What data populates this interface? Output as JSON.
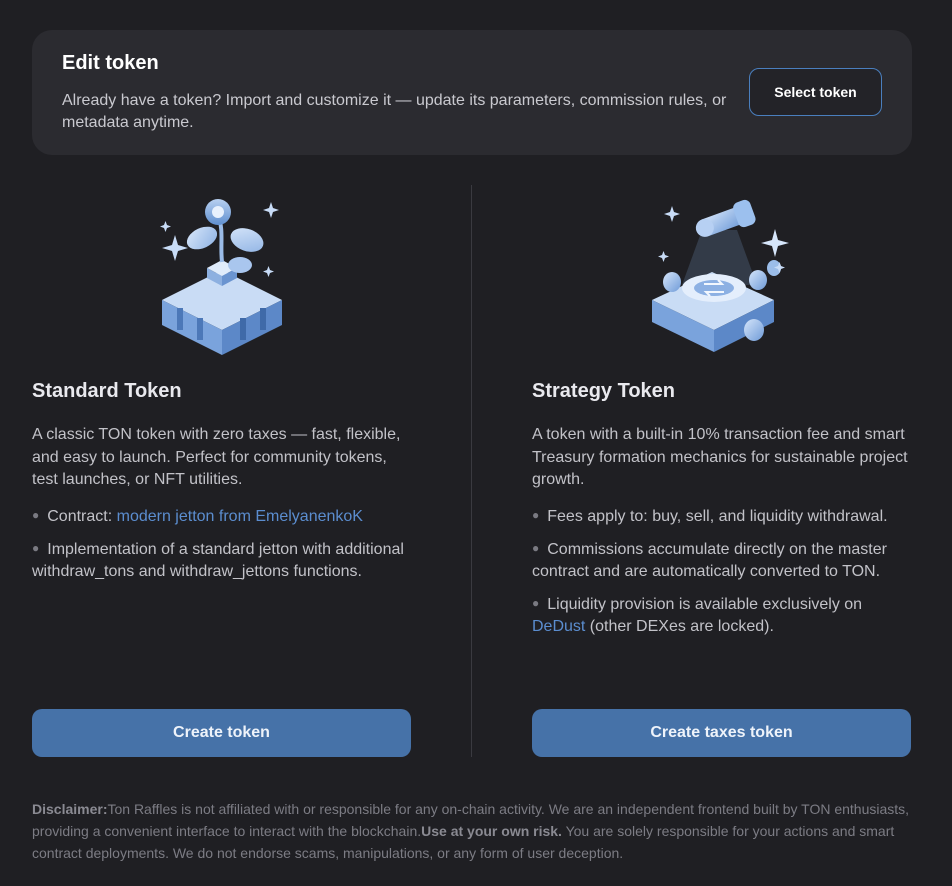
{
  "edit_card": {
    "title": "Edit token",
    "description": "Already have a token? Import and customize it — update its parameters, commission rules, or metadata anytime.",
    "select_button": "Select token"
  },
  "standard": {
    "title": "Standard Token",
    "description": "A classic TON token with zero taxes — fast, flexible, and easy to launch. Perfect for community tokens, test launches, or NFT utilities.",
    "bullet1_prefix": "Contract: ",
    "bullet1_link": "modern jetton from EmelyanenkoK",
    "bullet2": "Implementation of a standard jetton with additional withdraw_tons and withdraw_jettons functions.",
    "button": "Create token"
  },
  "strategy": {
    "title": "Strategy Token",
    "description": "A token with a built-in 10% transaction fee and smart Treasury formation mechanics for sustainable project growth.",
    "bullet1": "Fees apply to: buy, sell, and liquidity withdrawal.",
    "bullet2": "Commissions accumulate directly on the master contract and are automatically converted to TON.",
    "bullet3_prefix": "Liquidity provision is available exclusively on ",
    "bullet3_link": "DeDust",
    "bullet3_suffix": " (other DEXes are locked).",
    "button": "Create taxes token"
  },
  "disclaimer": {
    "label": "Disclaimer:",
    "text1": "Ton Raffles is not affiliated with or responsible for any on-chain activity. We are an independent frontend built by TON enthusiasts, providing a convenient interface to interact with the blockchain.",
    "emphasis": "Use at your own risk.",
    "text2": " You are solely responsible for your actions and smart contract deployments. We do not endorse scams, manipulations, or any form of user deception."
  },
  "icons": {
    "standard_illustration": "plant-on-blocks-icon",
    "strategy_illustration": "telescope-coins-icon",
    "sparkle": "sparkle-icon"
  },
  "colors": {
    "accent": "#4672a8",
    "link": "#5b8dcf",
    "background": "#1f1f23",
    "card": "#2b2b30"
  }
}
